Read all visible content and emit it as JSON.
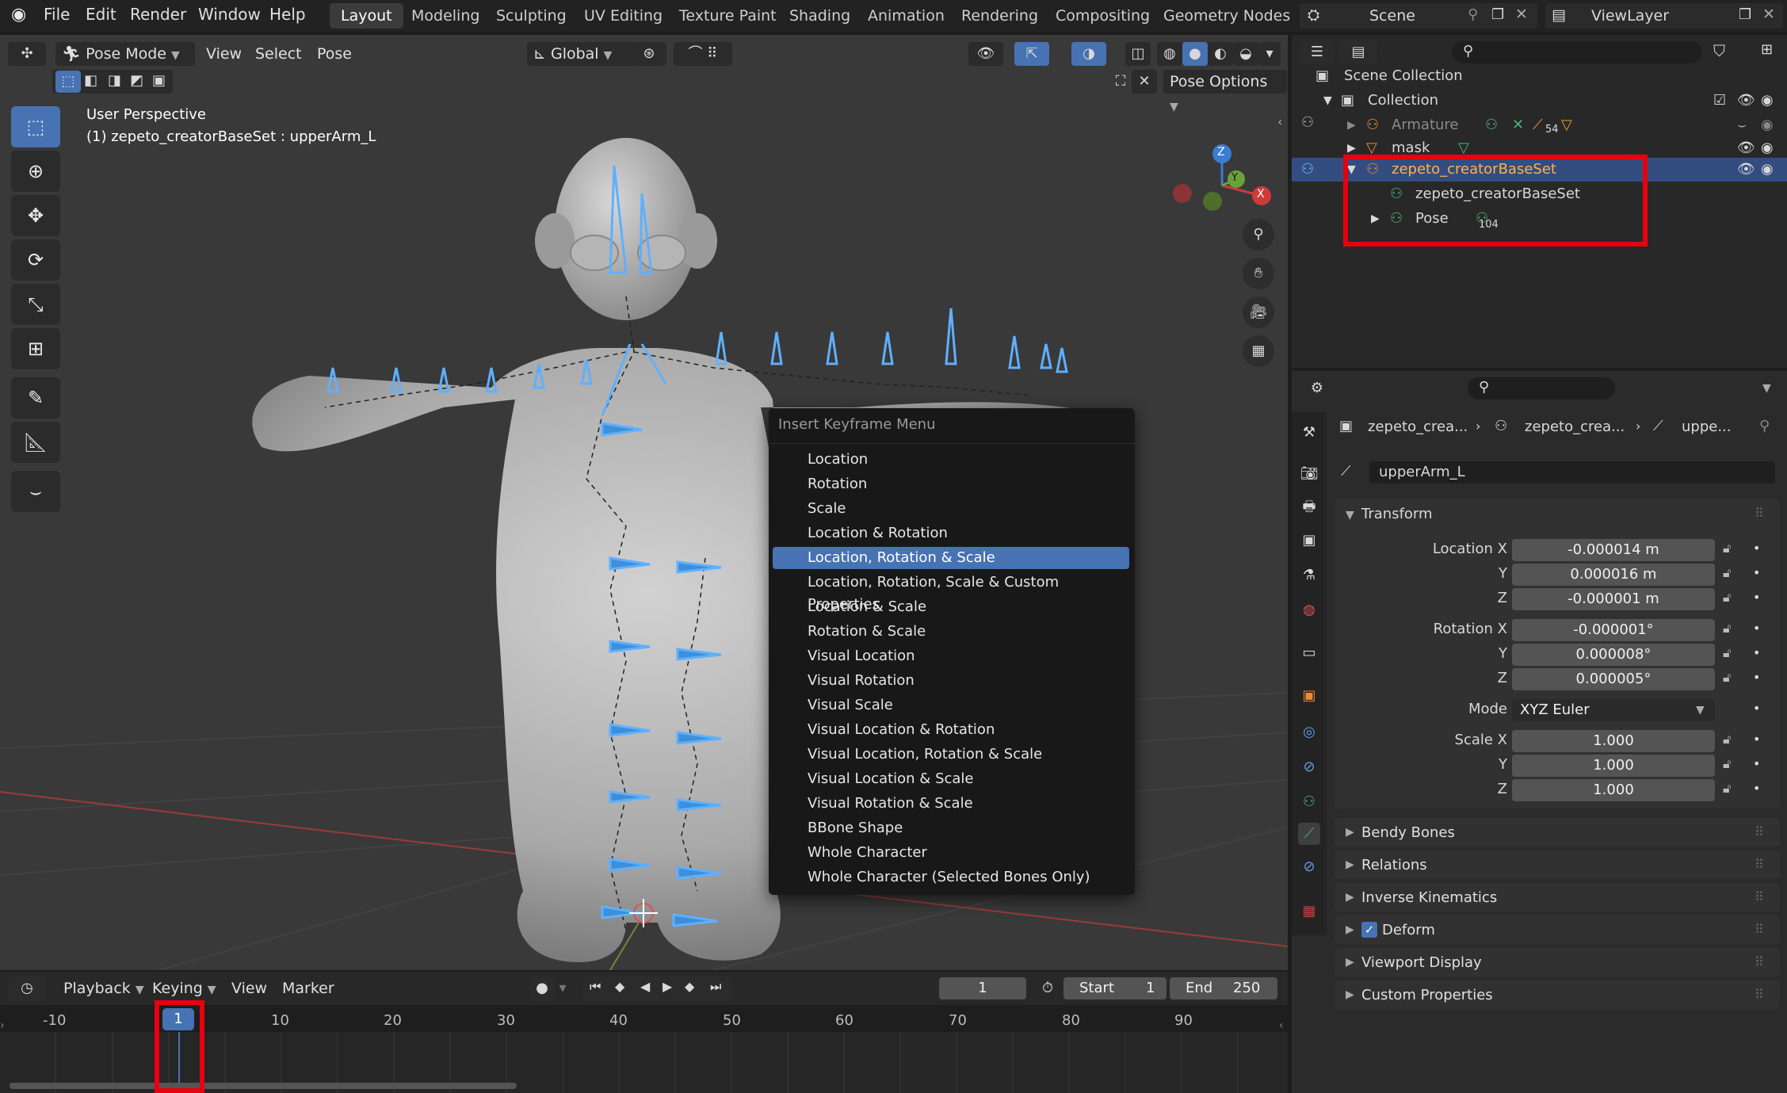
{
  "topbar": {
    "menus": [
      "File",
      "Edit",
      "Render",
      "Window",
      "Help"
    ],
    "workspaces": [
      "Layout",
      "Modeling",
      "Sculpting",
      "UV Editing",
      "Texture Paint",
      "Shading",
      "Animation",
      "Rendering",
      "Compositing",
      "Geometry Nodes"
    ],
    "active_workspace": "Layout",
    "scene": "Scene",
    "view_layer": "ViewLayer"
  },
  "viewport_header": {
    "mode": "Pose Mode",
    "menus": [
      "View",
      "Select",
      "Pose"
    ],
    "transform_orientation": "Global",
    "pose_options": "Pose Options"
  },
  "viewport": {
    "view_name": "User Perspective",
    "object_info": "(1) zepeto_creatorBaseSet : upperArm_L",
    "gizmo": {
      "x": "X",
      "y": "Y",
      "z": "Z"
    }
  },
  "keyframe_menu": {
    "title": "Insert Keyframe Menu",
    "items": [
      "Location",
      "Rotation",
      "Scale",
      "Location & Rotation",
      "Location, Rotation & Scale",
      "Location, Rotation, Scale & Custom Properties",
      "Location & Scale",
      "Rotation & Scale",
      "Visual Location",
      "Visual Rotation",
      "Visual Scale",
      "Visual Location & Rotation",
      "Visual Location, Rotation & Scale",
      "Visual Location & Scale",
      "Visual Rotation & Scale",
      "BBone Shape",
      "Whole Character",
      "Whole Character (Selected Bones Only)"
    ],
    "selected_index": 4
  },
  "outliner": {
    "scene_collection": "Scene Collection",
    "collection": "Collection",
    "armature": "Armature",
    "armature_count": "54",
    "mask": "mask",
    "selected_object": "zepeto_creatorBaseSet",
    "armature_data": "zepeto_creatorBaseSet",
    "pose": "Pose",
    "pose_count": "104"
  },
  "properties": {
    "breadcrumb": [
      "zepeto_crea...",
      "zepeto_crea...",
      "uppe..."
    ],
    "bone_name": "upperArm_L",
    "transform_title": "Transform",
    "location_label": "Location X",
    "location": [
      "-0.000014 m",
      "0.000016 m",
      "-0.000001 m"
    ],
    "rotation_label": "Rotation X",
    "rotation": [
      "-0.000001°",
      "0.000008°",
      "0.000005°"
    ],
    "mode_label": "Mode",
    "mode": "XYZ Euler",
    "scale_label": "Scale X",
    "scale": [
      "1.000",
      "1.000",
      "1.000"
    ],
    "axis_y": "Y",
    "axis_z": "Z",
    "panels": [
      "Bendy Bones",
      "Relations",
      "Inverse Kinematics",
      "Deform",
      "Viewport Display",
      "Custom Properties"
    ]
  },
  "timeline": {
    "menus": [
      "Playback",
      "Keying",
      "View",
      "Marker"
    ],
    "current_frame": "1",
    "start_label": "Start",
    "start": "1",
    "end_label": "End",
    "end": "250",
    "ticks": [
      "-10",
      "10",
      "20",
      "30",
      "40",
      "50",
      "60",
      "70",
      "80",
      "90"
    ],
    "playhead_frame": "1"
  }
}
